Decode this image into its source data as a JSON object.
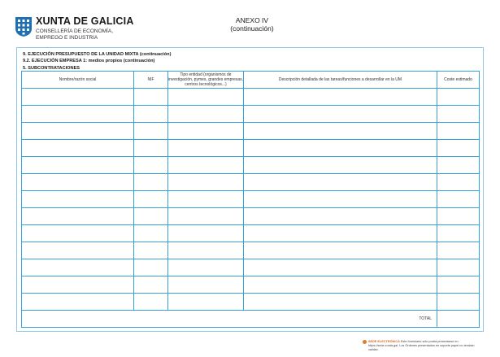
{
  "header": {
    "org_name": "XUNTA DE GALICIA",
    "org_sub_1": "CONSELLERÍA DE ECONOMÍA,",
    "org_sub_2": "EMPREGO E INDUSTRIA",
    "annex_line1": "ANEXO IV",
    "annex_line2": "(continuación)"
  },
  "sections": {
    "section_9": "9. EJECUCIÓN PRESUPUESTO DE LA UNIDAD MIXTA (continuación)",
    "section_9_2": "9.2. EJECUCIÓN EMPRESA 1: medios propios (continuación)",
    "section_5": "5. SUBCONTRATACIONES"
  },
  "table": {
    "col_name": "Nombre/razón social",
    "col_nif": "NIF",
    "col_type": "Tipo entidad (organismos de investigación, pymes, grandes empresas, centros tecnológicos...)",
    "col_desc": "Descripción detallada de las tareas/funciones  a desarrollar en la UM",
    "col_cost": "Coste estimado",
    "total_label": "TOTAL"
  },
  "footer": {
    "brand": "SEDE ELECTRÓNICA",
    "text": "Este formulario sólo podrá presentarse en https://sede.xunta.gal. Los Órdenes presentados en soporte papel no tendrán validez."
  },
  "colors": {
    "table_border": "#3aa0d8",
    "logo_blue": "#1f6fb2",
    "brand": "#d46a1e"
  }
}
